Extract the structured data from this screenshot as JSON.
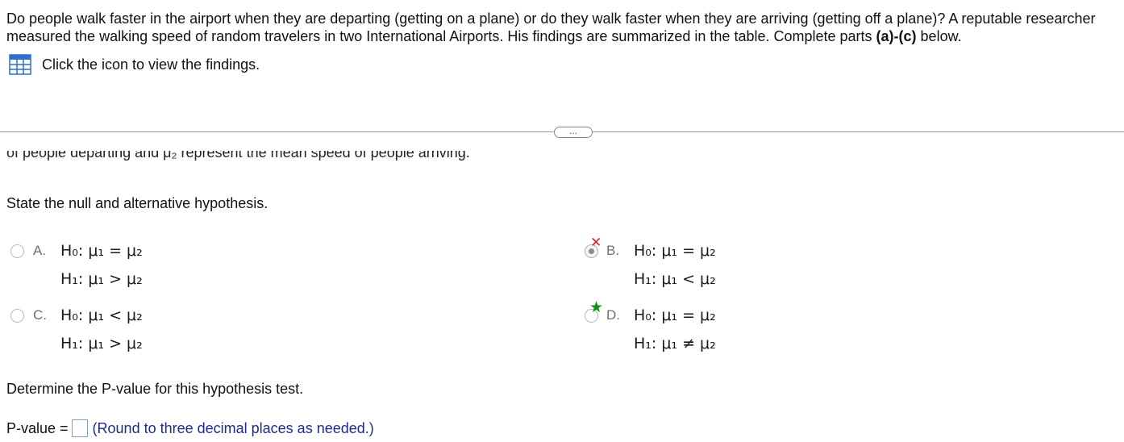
{
  "question": {
    "text_main": "Do people walk faster in the airport when they are departing (getting on a plane) or do they walk faster when they are arriving (getting off a plane)? A reputable researcher measured the walking speed of random travelers in two International Airports. His findings are summarized in the table. Complete parts ",
    "parts_bold": "(a)-(c)",
    "text_end": " below."
  },
  "findings_link": "Click the icon to view the findings.",
  "expand_label": "...",
  "clipped_line": "of people departing and μ₂ represent the mean speed of people arriving.",
  "prompt_hypothesis": "State the null and alternative hypothesis.",
  "choices": [
    {
      "letter": "A.",
      "h0": "H₀: μ₁ = μ₂",
      "h1": "H₁: μ₁ > μ₂",
      "state": "unselected"
    },
    {
      "letter": "B.",
      "h0": "H₀: μ₁ = μ₂",
      "h1": "H₁: μ₁ < μ₂",
      "state": "selected-incorrect"
    },
    {
      "letter": "C.",
      "h0": "H₀: μ₁ < μ₂",
      "h1": "H₁: μ₁ > μ₂",
      "state": "unselected"
    },
    {
      "letter": "D.",
      "h0": "H₀: μ₁ = μ₂",
      "h1": "H₁: μ₁ ≠ μ₂",
      "state": "correct-answer"
    }
  ],
  "prompt_pvalue": "Determine the P-value for this hypothesis test.",
  "pvalue": {
    "label": "P-value =",
    "value": "",
    "hint": "(Round to three decimal places as needed.)"
  },
  "colors": {
    "incorrect": "#e02020",
    "correct": "#129212",
    "hint": "#1f2a8c"
  }
}
